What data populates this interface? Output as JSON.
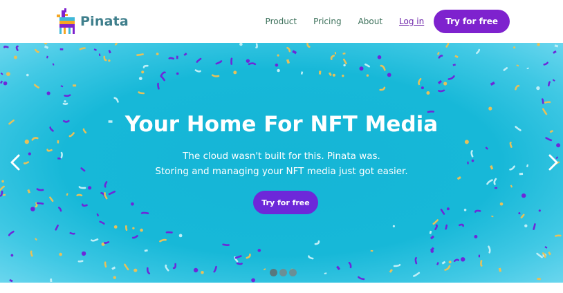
{
  "header": {
    "brand": "Pinata",
    "nav": [
      {
        "label": "Product"
      },
      {
        "label": "Pricing"
      },
      {
        "label": "About"
      }
    ],
    "login_label": "Log in",
    "cta_label": "Try for free"
  },
  "hero": {
    "title": "Your Home For NFT Media",
    "subtitle_line1": "The cloud wasn't built for this. Pinata was.",
    "subtitle_line2": "Storing and managing your NFT media just got easier.",
    "cta_label": "Try for free",
    "prev_icon": "chevron-left-icon",
    "next_icon": "chevron-right-icon",
    "slides": 3,
    "active_slide": 1
  },
  "colors": {
    "brand_text": "#3f7f8c",
    "nav_text": "#3a6f59",
    "accent": "#7e22ce",
    "hero_bg": "#17b8d8",
    "confetti_purple": "#6d28d9",
    "confetti_gold": "#e6c15a",
    "confetti_light": "#bfeff7"
  }
}
